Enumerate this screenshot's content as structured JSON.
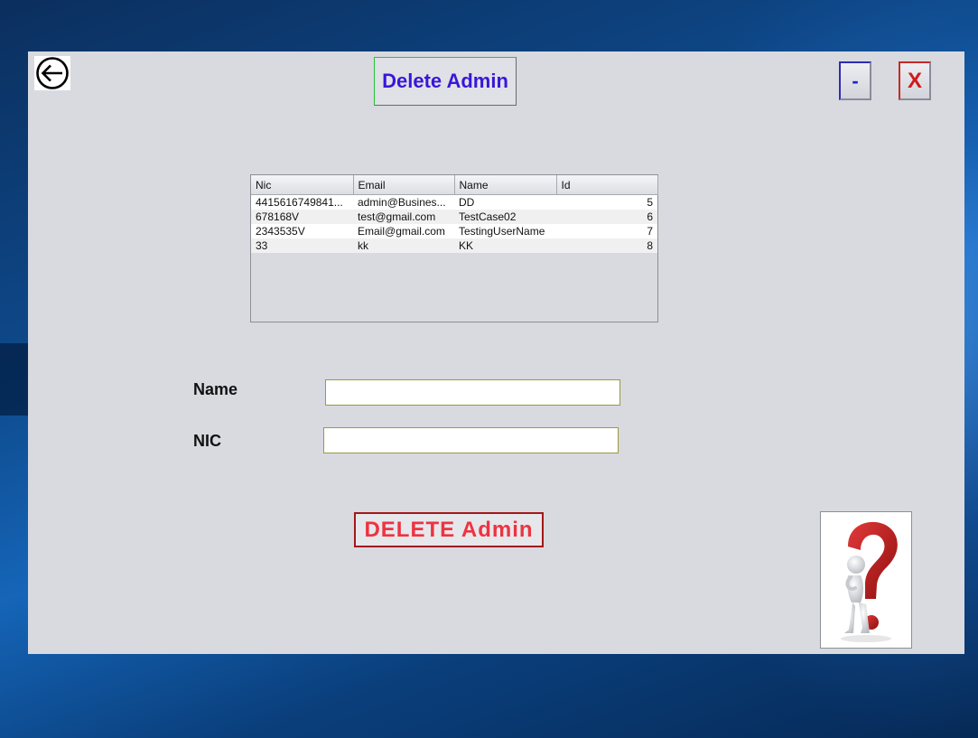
{
  "window": {
    "title": "Delete Admin",
    "minimize_label": "-",
    "close_label": "X"
  },
  "table": {
    "columns": [
      "Nic",
      "Email",
      "Name",
      "Id"
    ],
    "rows": [
      [
        "4415616749841...",
        "admin@Busines...",
        "DD",
        "5"
      ],
      [
        "678168V",
        "test@gmail.com",
        "TestCase02",
        "6"
      ],
      [
        "2343535V",
        "Email@gmail.com",
        "TestingUserName",
        "7"
      ],
      [
        "33",
        "kk",
        "KK",
        "8"
      ]
    ]
  },
  "form": {
    "name_label": "Name",
    "name_value": "",
    "nic_label": "NIC",
    "nic_value": ""
  },
  "actions": {
    "delete_label": "DELETE Admin"
  },
  "icons": {
    "back": "back-arrow-icon",
    "help": "help-question-figure-icon"
  },
  "colors": {
    "title_text": "#3a16d8",
    "delete_text": "#ee3340",
    "close_text": "#d01a1a",
    "minimize_text": "#2222cc",
    "window_bg": "#d8dae0"
  }
}
